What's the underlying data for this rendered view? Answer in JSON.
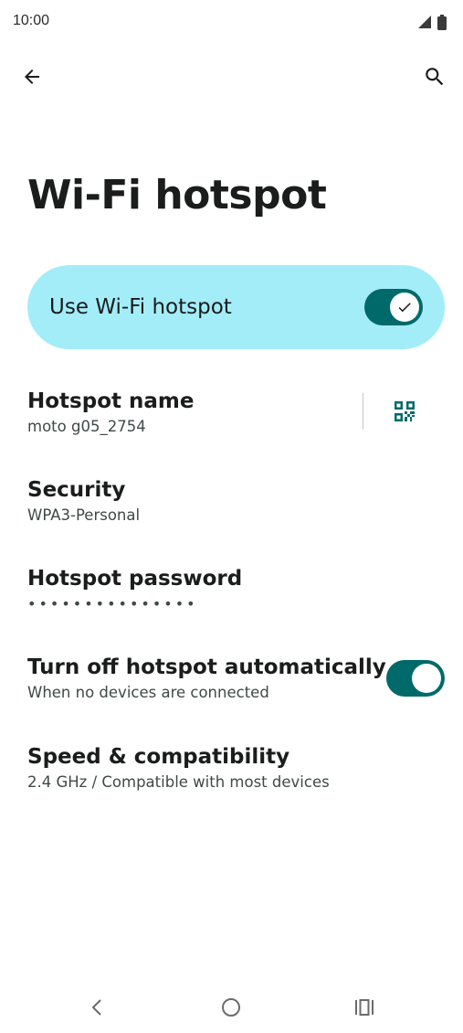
{
  "status_bar": {
    "time": "10:00",
    "icons": [
      "cellular-signal-icon",
      "battery-icon"
    ]
  },
  "top_bar": {
    "back_icon": "arrow-back-icon",
    "search_icon": "search-icon"
  },
  "page": {
    "title": "Wi-Fi hotspot"
  },
  "master_switch": {
    "label": "Use Wi-Fi hotspot",
    "checked": true
  },
  "preferences": {
    "hotspot_name": {
      "title": "Hotspot name",
      "summary": "moto g05_2754",
      "action_icon": "qr-code-icon"
    },
    "security": {
      "title": "Security",
      "summary": "WPA3-Personal"
    },
    "password": {
      "title": "Hotspot password",
      "summary": "•••••••••••••••"
    },
    "auto_off": {
      "title": "Turn off hotspot automatically",
      "summary": "When no devices are connected",
      "checked": true
    },
    "speed": {
      "title": "Speed & compatibility",
      "summary": "2.4 GHz / Compatible with most devices"
    }
  },
  "colors": {
    "accent": "#006a6a",
    "switch_bar": "#a3edf9"
  },
  "nav_bar": {
    "icons": [
      "nav-back-icon",
      "nav-home-icon",
      "nav-recents-icon"
    ]
  }
}
